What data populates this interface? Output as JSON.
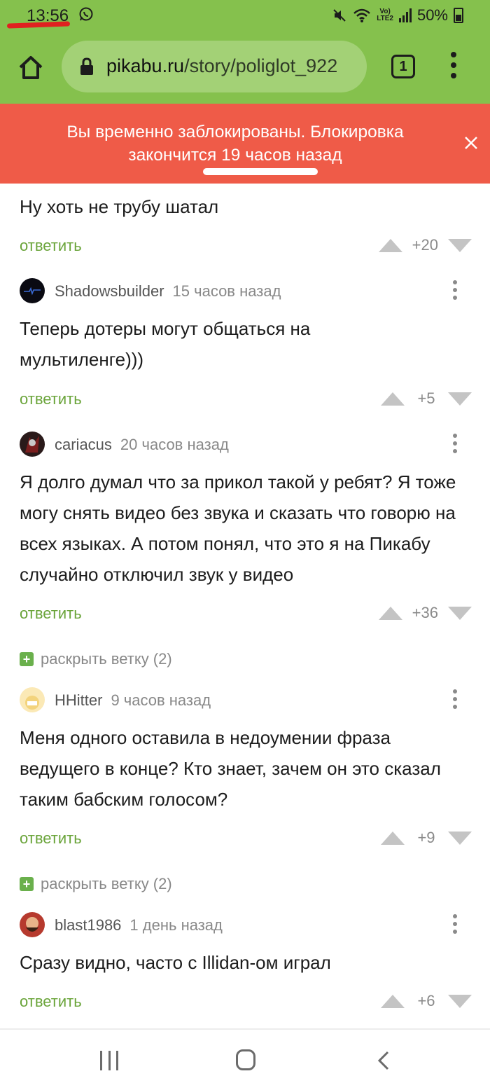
{
  "status_bar": {
    "time": "13:56",
    "battery": "50%",
    "network_label_top": "Vo)",
    "network_label_bottom": "LTE2",
    "icons": [
      "whatsapp-icon",
      "mute-icon",
      "wifi-icon",
      "signal-icon",
      "battery-icon"
    ]
  },
  "browser": {
    "url_host": "pikabu.ru",
    "url_path": "/story/poliglot_922",
    "tab_count": "1",
    "icons": [
      "home-icon",
      "lock-icon",
      "tabs-icon",
      "menu-icon"
    ]
  },
  "banner": {
    "text": "Вы временно заблокированы. Блокировка закончится 19 часов назад",
    "color": "#ef5b48"
  },
  "comments": [
    {
      "text": "Ну хоть не трубу шатал",
      "reply": "ответить",
      "score": "+20"
    },
    {
      "user": "Shadowsbuilder",
      "time": "15 часов назад",
      "text": "Теперь дотеры могут общаться на мультиленге)))",
      "reply": "ответить",
      "score": "+5"
    },
    {
      "user": "cariacus",
      "time": "20 часов назад",
      "text": "Я долго думал что за прикол такой у ребят? Я тоже могу снять видео без звука и сказать что говорю на всех языках. А потом понял, что это я на Пикабу случайно отключил звук у видео",
      "reply": "ответить",
      "score": "+36"
    },
    {
      "user": "HHitter",
      "time": "9 часов назад",
      "text": "Меня одного оставила в недоумении фраза ведущего в конце? Кто знает, зачем он это сказал таким бабским голосом?",
      "reply": "ответить",
      "score": "+9"
    },
    {
      "user": "blast1986",
      "time": "1 день назад",
      "text": "Сразу видно, часто с Illidan-ом играл",
      "reply": "ответить",
      "score": "+6"
    }
  ],
  "expand_branch": [
    {
      "label": "раскрыть ветку (2)"
    },
    {
      "label": "раскрыть ветку (2)"
    }
  ],
  "colors": {
    "browser_green": "#85c14d",
    "link_green": "#6aa43a"
  },
  "nav": {
    "icons": [
      "recent-apps-icon",
      "home-button-icon",
      "back-icon"
    ]
  }
}
